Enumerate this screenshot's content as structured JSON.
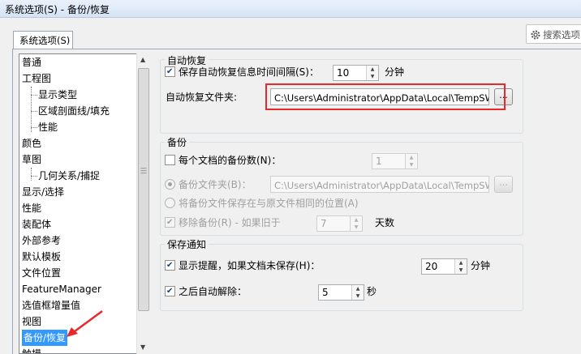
{
  "window": {
    "title": "系统选项(S) - 备份/恢复"
  },
  "tabs": [
    {
      "label": "系统选项(S)"
    }
  ],
  "search": {
    "icon": "gear-icon",
    "placeholder": "搜索选项"
  },
  "tree": {
    "items": [
      {
        "label": "普通",
        "level": 0
      },
      {
        "label": "工程图",
        "level": 0
      },
      {
        "label": "显示类型",
        "level": 1
      },
      {
        "label": "区域剖面线/填充",
        "level": 1
      },
      {
        "label": "性能",
        "level": 1
      },
      {
        "label": "颜色",
        "level": 0
      },
      {
        "label": "草图",
        "level": 0
      },
      {
        "label": "几何关系/捕捉",
        "level": 1
      },
      {
        "label": "显示/选择",
        "level": 0
      },
      {
        "label": "性能",
        "level": 0
      },
      {
        "label": "装配体",
        "level": 0
      },
      {
        "label": "外部参考",
        "level": 0
      },
      {
        "label": "默认模板",
        "level": 0
      },
      {
        "label": "文件位置",
        "level": 0
      },
      {
        "label": "FeatureManager",
        "level": 0
      },
      {
        "label": "选值框增量值",
        "level": 0
      },
      {
        "label": "视图",
        "level": 0
      },
      {
        "label": "备份/恢复",
        "level": 0,
        "selected": true
      },
      {
        "label": "触摸",
        "level": 0
      }
    ]
  },
  "auto_recover": {
    "title": "自动恢复",
    "save_interval_label": "保存自动恢复信息时间间隔(S)：",
    "save_interval_checked": true,
    "save_interval_value": "10",
    "save_interval_unit": "分钟",
    "folder_label": "自动恢复文件夹:",
    "folder_value": "C:\\Users\\Administrator\\AppData\\Local\\TempSW备份",
    "browse_label": "..."
  },
  "backup": {
    "title": "备份",
    "copies_label": "每个文档的备份数(N)：",
    "copies_checked": false,
    "copies_value": "1",
    "folder_radio_label": "备份文件夹(B)：",
    "folder_value": "C:\\Users\\Administrator\\AppData\\Local\\TempSW备份",
    "browse_label": "...",
    "same_location_label": "将备份文件保存在与原文件相同的位置(A)",
    "remove_label": "移除备份(R) - 如果旧于",
    "remove_checked": true,
    "remove_value": "7",
    "remove_unit": "天数"
  },
  "save_notify": {
    "title": "保存通知",
    "show_reminder_label": "显示提醒，如果文档未保存(H)：",
    "show_reminder_checked": true,
    "show_reminder_value": "20",
    "show_reminder_unit": "分钟",
    "auto_dismiss_label": "之后自动解除：",
    "auto_dismiss_checked": true,
    "auto_dismiss_value": "5",
    "auto_dismiss_unit": "秒"
  },
  "colors": {
    "selection": "#3399ff",
    "highlight_box": "#e8282c"
  }
}
